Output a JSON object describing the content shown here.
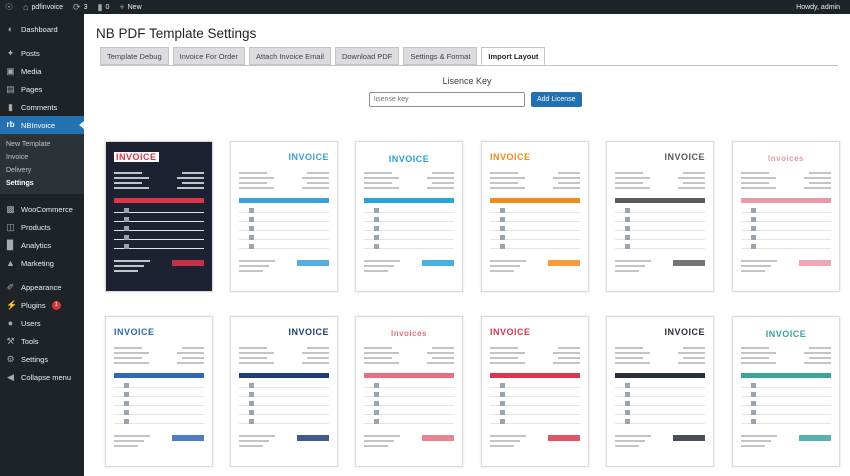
{
  "adminbar": {
    "site_name": "pdfinvoice",
    "updates_count": "3",
    "comments_count": "0",
    "new_label": "New",
    "howdy": "Howdy, admin"
  },
  "sidebar": {
    "items": [
      {
        "label": "Dashboard",
        "icon": "dashboard-icon"
      },
      {
        "label": "Posts",
        "icon": "pin-icon"
      },
      {
        "label": "Media",
        "icon": "media-icon"
      },
      {
        "label": "Pages",
        "icon": "pages-icon"
      },
      {
        "label": "Comments",
        "icon": "comments-icon"
      },
      {
        "label": "NBInvoice",
        "icon": "nb-icon"
      },
      {
        "label": "WooCommerce",
        "icon": "woo-icon"
      },
      {
        "label": "Products",
        "icon": "products-icon"
      },
      {
        "label": "Analytics",
        "icon": "analytics-icon"
      },
      {
        "label": "Marketing",
        "icon": "marketing-icon"
      },
      {
        "label": "Appearance",
        "icon": "brush-icon"
      },
      {
        "label": "Plugins",
        "icon": "plugin-icon",
        "badge": "1"
      },
      {
        "label": "Users",
        "icon": "users-icon"
      },
      {
        "label": "Tools",
        "icon": "wrench-icon"
      },
      {
        "label": "Settings",
        "icon": "settings-icon"
      },
      {
        "label": "Collapse menu",
        "icon": "collapse-icon"
      }
    ],
    "submenu": [
      "New Template",
      "Invoice",
      "Delivery",
      "Settings"
    ]
  },
  "main": {
    "title": "NB PDF Template Settings",
    "tabs": [
      "Template Debug",
      "Invoice For Order",
      "Attach Invoice Email",
      "Download PDF",
      "Settings & Format",
      "Import Layout"
    ],
    "licence_title": "Lisence Key",
    "licence_placeholder": "lisense key",
    "licence_button": "Add License",
    "templates": [
      {
        "word": "INVOICE",
        "accent": "#e0344b",
        "dark": "#1d2233"
      },
      {
        "word": "INVOICE",
        "accent": "#3aa0d8",
        "dark": "#ffffff"
      },
      {
        "word": "INVOICE",
        "accent": "#2aa3d8",
        "dark": "#ffffff"
      },
      {
        "word": "INVOICE",
        "accent": "#f28a1c",
        "dark": "#ffffff"
      },
      {
        "word": "INVOICE",
        "accent": "#5a5a5a",
        "dark": "#ffffff"
      },
      {
        "word": "Invoices",
        "accent": "#e79aa6",
        "dark": "#ffffff"
      },
      {
        "word": "INVOICE",
        "accent": "#2d68b5",
        "dark": "#ffffff"
      },
      {
        "word": "INVOICE",
        "accent": "#1f3e78",
        "dark": "#ffffff"
      },
      {
        "word": "Invoices",
        "accent": "#e5707f",
        "dark": "#ffffff"
      },
      {
        "word": "INVOICE",
        "accent": "#d9364b",
        "dark": "#ffffff"
      },
      {
        "word": "INVOICE",
        "accent": "#2b2f3a",
        "dark": "#ffffff"
      },
      {
        "word": "INVOICE",
        "accent": "#3aa59b",
        "dark": "#ffffff"
      }
    ]
  }
}
